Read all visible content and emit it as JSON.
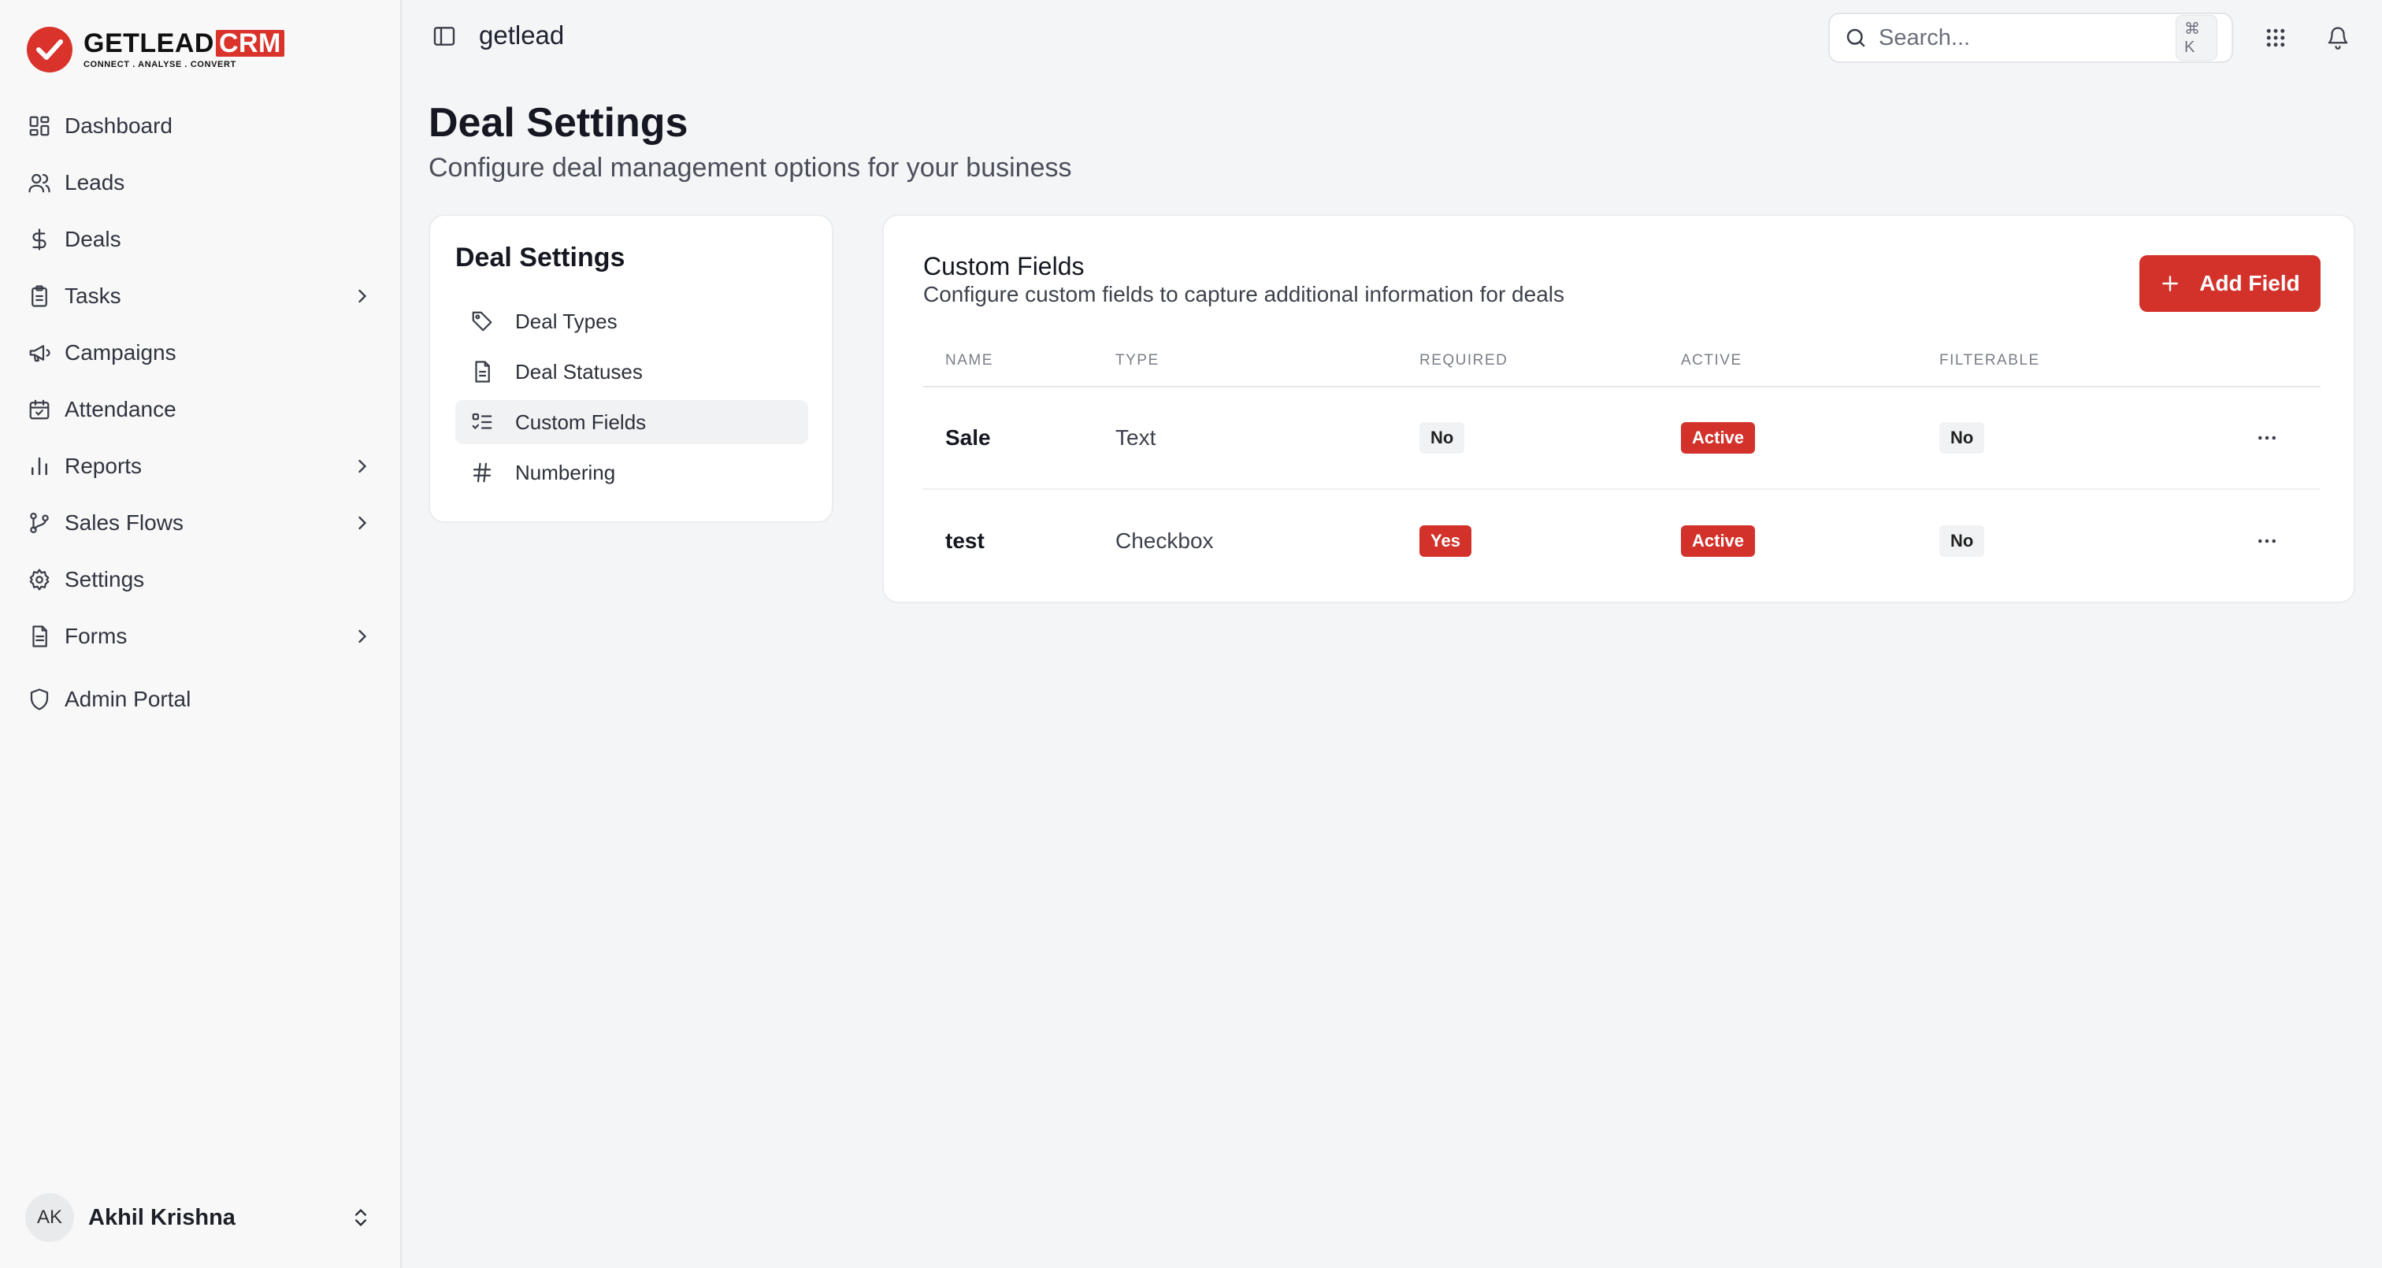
{
  "brand": {
    "name": "GETLEAD",
    "badge": "CRM",
    "tagline": "CONNECT  .  ANALYSE  .  CONVERT",
    "accent_color": "#d9332b"
  },
  "sidebar": {
    "items": [
      {
        "label": "Dashboard",
        "icon": "grid-icon",
        "has_chevron": false
      },
      {
        "label": "Leads",
        "icon": "users-icon",
        "has_chevron": false
      },
      {
        "label": "Deals",
        "icon": "dollar-icon",
        "has_chevron": false
      },
      {
        "label": "Tasks",
        "icon": "clipboard-icon",
        "has_chevron": true
      },
      {
        "label": "Campaigns",
        "icon": "megaphone-icon",
        "has_chevron": false
      },
      {
        "label": "Attendance",
        "icon": "calendar-check-icon",
        "has_chevron": false
      },
      {
        "label": "Reports",
        "icon": "bar-chart-icon",
        "has_chevron": true
      },
      {
        "label": "Sales Flows",
        "icon": "git-branch-icon",
        "has_chevron": true
      },
      {
        "label": "Settings",
        "icon": "gear-icon",
        "has_chevron": false
      },
      {
        "label": "Forms",
        "icon": "file-icon",
        "has_chevron": true
      }
    ],
    "admin": {
      "label": "Admin Portal",
      "icon": "shield-icon"
    },
    "user": {
      "initials": "AK",
      "name": "Akhil Krishna"
    }
  },
  "topbar": {
    "workspace": "getlead",
    "search_placeholder": "Search...",
    "search_shortcut": "⌘ K"
  },
  "page": {
    "title": "Deal Settings",
    "subtitle": "Configure deal management options for your business"
  },
  "settings_menu": {
    "title": "Deal Settings",
    "items": [
      {
        "label": "Deal Types",
        "icon": "tag-icon",
        "active": false
      },
      {
        "label": "Deal Statuses",
        "icon": "document-icon",
        "active": false
      },
      {
        "label": "Custom Fields",
        "icon": "checklist-icon",
        "active": true
      },
      {
        "label": "Numbering",
        "icon": "hash-icon",
        "active": false
      }
    ]
  },
  "custom_fields": {
    "title": "Custom Fields",
    "description": "Configure custom fields to capture additional information for deals",
    "add_button": "Add Field",
    "columns": [
      "NAME",
      "TYPE",
      "REQUIRED",
      "ACTIVE",
      "FILTERABLE"
    ],
    "rows": [
      {
        "name": "Sale",
        "type": "Text",
        "required": "No",
        "active": "Active",
        "filterable": "No"
      },
      {
        "name": "test",
        "type": "Checkbox",
        "required": "Yes",
        "active": "Active",
        "filterable": "No"
      }
    ]
  }
}
